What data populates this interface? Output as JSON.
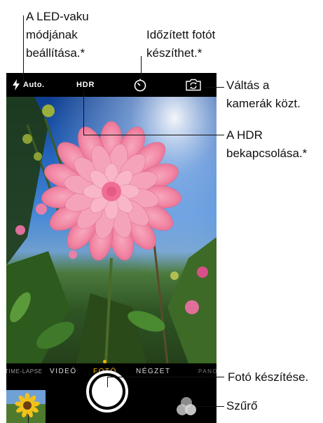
{
  "topbar": {
    "flash_icon": "flash-bolt-icon",
    "flash_label": "Auto.",
    "hdr_label": "HDR",
    "timer_icon": "timer-icon",
    "switch_icon": "camera-switch-icon"
  },
  "modes": {
    "items": [
      "TIME-LAPSE",
      "VIDEÓ",
      "FOTÓ",
      "NÉGZET",
      "PANO"
    ],
    "selected": "FOTÓ"
  },
  "bottom": {
    "thumbnail_icon": "sunflower-thumbnail",
    "shutter_icon": "shutter-button",
    "filter_icon": "filter-circles-icon"
  },
  "callouts": {
    "flash": "A LED-vaku\nmódjának\nbeállítása.*",
    "timer": "Időzített fotót\nkészíthet.*",
    "switch": "Váltás a\nkamerák közt.",
    "hdr": "A HDR\nbekapcsolása.*",
    "shutter": "Fotó készítése.",
    "filter": "Szűrő"
  },
  "colors": {
    "accent_yellow": "#f3b800",
    "bar_black": "#000000",
    "annotation_text": "#111111"
  }
}
